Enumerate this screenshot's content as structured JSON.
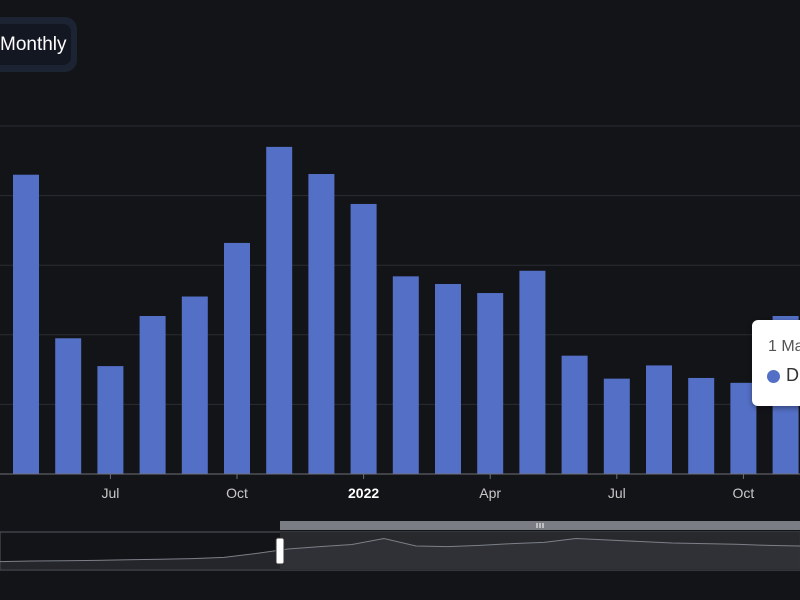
{
  "toggle": {
    "label": "Monthly"
  },
  "colors": {
    "background": "#131418",
    "bar": "#5470c6",
    "grid": "#2a2c33",
    "axis_text": "#c8c8c8",
    "slider_fill": "#2a2b30"
  },
  "tooltip": {
    "date": "1 Ma",
    "series": "D"
  },
  "chart_data": {
    "type": "bar",
    "x": [
      "2021-05",
      "2021-06",
      "2021-07",
      "2021-08",
      "2021-09",
      "2021-10",
      "2021-11",
      "2021-12",
      "2022-01",
      "2022-02",
      "2022-03",
      "2022-04",
      "2022-05",
      "2022-06",
      "2022-07",
      "2022-08",
      "2022-09",
      "2022-10",
      "2022-11"
    ],
    "values": [
      4.3,
      1.95,
      1.55,
      2.27,
      2.55,
      3.32,
      4.7,
      4.31,
      3.88,
      2.84,
      2.73,
      2.6,
      2.92,
      1.7,
      1.37,
      1.56,
      1.38,
      1.31,
      2.27
    ],
    "ylim": [
      0,
      5
    ],
    "x_tick_labels": [
      {
        "x": "2021-07",
        "label": "Jul",
        "bold": false
      },
      {
        "x": "2021-10",
        "label": "Oct",
        "bold": false
      },
      {
        "x": "2022-01",
        "label": "2022",
        "bold": true
      },
      {
        "x": "2022-04",
        "label": "Apr",
        "bold": false
      },
      {
        "x": "2022-07",
        "label": "Jul",
        "bold": false
      },
      {
        "x": "2022-10",
        "label": "Oct",
        "bold": false
      }
    ],
    "grid": true,
    "zoom_slider": {
      "start_percent": 35,
      "end_percent": 100,
      "overview": [
        0.18,
        0.2,
        0.21,
        0.22,
        0.24,
        0.26,
        0.28,
        0.32,
        0.45,
        0.6,
        0.68,
        0.75,
        0.95,
        0.7,
        0.68,
        0.72,
        0.78,
        0.82,
        0.95,
        0.9,
        0.85,
        0.8,
        0.78,
        0.76,
        0.72,
        0.7
      ]
    }
  }
}
